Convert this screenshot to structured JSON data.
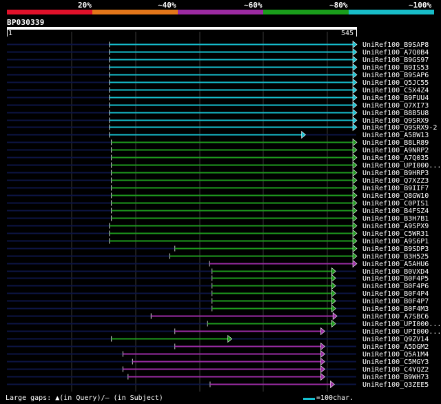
{
  "legend": {
    "labels": [
      "20%",
      "~40%",
      "~60%",
      "~80%",
      "~100%"
    ],
    "colors": [
      "#e0112a",
      "#e2761a",
      "#9b2aa1",
      "#1a9d1b",
      "#18bcc8"
    ]
  },
  "query": {
    "name": "BP030339",
    "start": "1",
    "end": "545"
  },
  "footer": {
    "gaps_text": "Large gaps: ▲(in Query)/— (in Subject)",
    "scale_text": "=100char."
  },
  "hits": [
    {
      "name": "UniRef100_B9SAP8",
      "start": 160,
      "end": 545,
      "color": "cyan"
    },
    {
      "name": "UniRef100_A7Q0B4",
      "start": 160,
      "end": 545,
      "color": "cyan"
    },
    {
      "name": "UniRef100_B9GS97",
      "start": 160,
      "end": 545,
      "color": "cyan"
    },
    {
      "name": "UniRef100_B9IS53",
      "start": 160,
      "end": 545,
      "color": "cyan"
    },
    {
      "name": "UniRef100_B9SAP6",
      "start": 160,
      "end": 545,
      "color": "cyan"
    },
    {
      "name": "UniRef100_Q5JC55",
      "start": 160,
      "end": 545,
      "color": "cyan"
    },
    {
      "name": "UniRef100_C5X4Z4",
      "start": 160,
      "end": 545,
      "color": "cyan"
    },
    {
      "name": "UniRef100_B9FUU4",
      "start": 160,
      "end": 545,
      "color": "cyan"
    },
    {
      "name": "UniRef100_Q7XI73",
      "start": 160,
      "end": 545,
      "color": "cyan"
    },
    {
      "name": "UniRef100_B8B5U8",
      "start": 160,
      "end": 545,
      "color": "cyan"
    },
    {
      "name": "UniRef100_Q9SRX9",
      "start": 160,
      "end": 545,
      "color": "cyan"
    },
    {
      "name": "UniRef100_Q9SRX9-2",
      "start": 160,
      "end": 545,
      "color": "cyan"
    },
    {
      "name": "UniRef100_A5BW13",
      "start": 160,
      "end": 465,
      "color": "cyan"
    },
    {
      "name": "UniRef100_B8LR89",
      "start": 163,
      "end": 545,
      "color": "green"
    },
    {
      "name": "UniRef100_A9NRP2",
      "start": 163,
      "end": 545,
      "color": "green"
    },
    {
      "name": "UniRef100_A7Q035",
      "start": 163,
      "end": 545,
      "color": "green"
    },
    {
      "name": "UniRef100_UPI000...",
      "start": 163,
      "end": 545,
      "color": "green"
    },
    {
      "name": "UniRef100_B9HRP3",
      "start": 163,
      "end": 545,
      "color": "green"
    },
    {
      "name": "UniRef100_Q7XZZ3",
      "start": 163,
      "end": 545,
      "color": "green"
    },
    {
      "name": "UniRef100_B9IIF7",
      "start": 163,
      "end": 545,
      "color": "green"
    },
    {
      "name": "UniRef100_Q8GW10",
      "start": 163,
      "end": 545,
      "color": "green"
    },
    {
      "name": "UniRef100_C0PIS1",
      "start": 163,
      "end": 545,
      "color": "green"
    },
    {
      "name": "UniRef100_B4FSZ4",
      "start": 163,
      "end": 545,
      "color": "green"
    },
    {
      "name": "UniRef100_B3H7B1",
      "start": 163,
      "end": 545,
      "color": "green"
    },
    {
      "name": "UniRef100_A9SPX9",
      "start": 160,
      "end": 545,
      "color": "green"
    },
    {
      "name": "UniRef100_C5WR31",
      "start": 160,
      "end": 545,
      "color": "green"
    },
    {
      "name": "UniRef100_A9S6P1",
      "start": 160,
      "end": 545,
      "color": "green"
    },
    {
      "name": "UniRef100_B9SDP3",
      "start": 262,
      "end": 545,
      "color": "green"
    },
    {
      "name": "UniRef100_B3H525",
      "start": 254,
      "end": 545,
      "color": "green"
    },
    {
      "name": "UniRef100_A5AHU6",
      "start": 316,
      "end": 545,
      "color": "purple"
    },
    {
      "name": "UniRef100_B0VXD4",
      "start": 320,
      "end": 512,
      "color": "green"
    },
    {
      "name": "UniRef100_B0F4P5",
      "start": 320,
      "end": 512,
      "color": "green"
    },
    {
      "name": "UniRef100_B0F4P6",
      "start": 320,
      "end": 512,
      "color": "green"
    },
    {
      "name": "UniRef100_B0F4P4",
      "start": 320,
      "end": 512,
      "color": "green"
    },
    {
      "name": "UniRef100_B0F4P7",
      "start": 320,
      "end": 512,
      "color": "green"
    },
    {
      "name": "UniRef100_B0F4M3",
      "start": 320,
      "end": 512,
      "color": "green"
    },
    {
      "name": "UniRef100_A7SBC6",
      "start": 225,
      "end": 514,
      "color": "purple"
    },
    {
      "name": "UniRef100_UPI000...",
      "start": 313,
      "end": 512,
      "color": "green"
    },
    {
      "name": "UniRef100_UPI000...",
      "start": 262,
      "end": 495,
      "color": "purple"
    },
    {
      "name": "UniRef100_Q9ZV14",
      "start": 163,
      "end": 350,
      "color": "green"
    },
    {
      "name": "UniRef100_A5DGM2",
      "start": 262,
      "end": 495,
      "color": "purple"
    },
    {
      "name": "UniRef100_Q5A1M4",
      "start": 181,
      "end": 495,
      "color": "purple"
    },
    {
      "name": "UniRef100_C5MGY3",
      "start": 196,
      "end": 495,
      "color": "purple"
    },
    {
      "name": "UniRef100_C4YQZ2",
      "start": 181,
      "end": 495,
      "color": "purple"
    },
    {
      "name": "UniRef100_B9WH73",
      "start": 189,
      "end": 495,
      "color": "purple"
    },
    {
      "name": "UniRef100_Q3ZEE5",
      "start": 317,
      "end": 510,
      "color": "purple"
    }
  ]
}
